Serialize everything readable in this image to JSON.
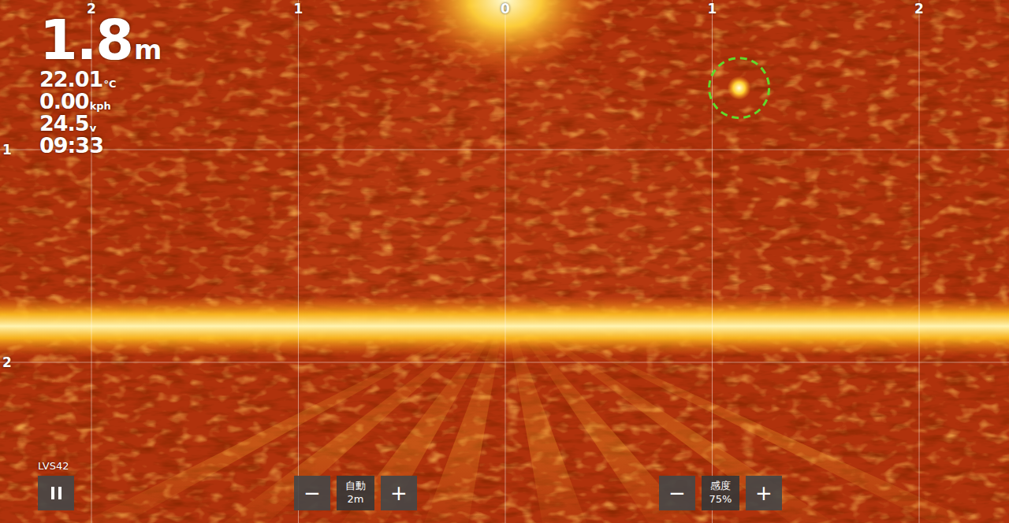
{
  "depth": {
    "value": "1.8",
    "unit": "m"
  },
  "readouts": [
    {
      "value": "22.01",
      "unit": "°C"
    },
    {
      "value": "0.00",
      "unit": "kph"
    },
    {
      "value": "24.5",
      "unit": "v"
    },
    {
      "value": "09:33",
      "unit": ""
    }
  ],
  "sonar": {
    "x_axis": {
      "ticks": [
        "2",
        "1",
        "0",
        "1",
        "2"
      ]
    },
    "y_axis": {
      "ticks": [
        "1",
        "2"
      ]
    },
    "bottom_depth_m": 1.83,
    "targets": [
      {
        "x_m": 1.13,
        "depth_m": 0.71,
        "marked": true
      }
    ]
  },
  "transducer": {
    "label": "LVS42"
  },
  "controls": [
    {
      "label": "自動",
      "value": "2m",
      "decrement": "−",
      "increment": "+"
    },
    {
      "label": "感度",
      "value": "75%",
      "decrement": "−",
      "increment": "+"
    }
  ]
}
